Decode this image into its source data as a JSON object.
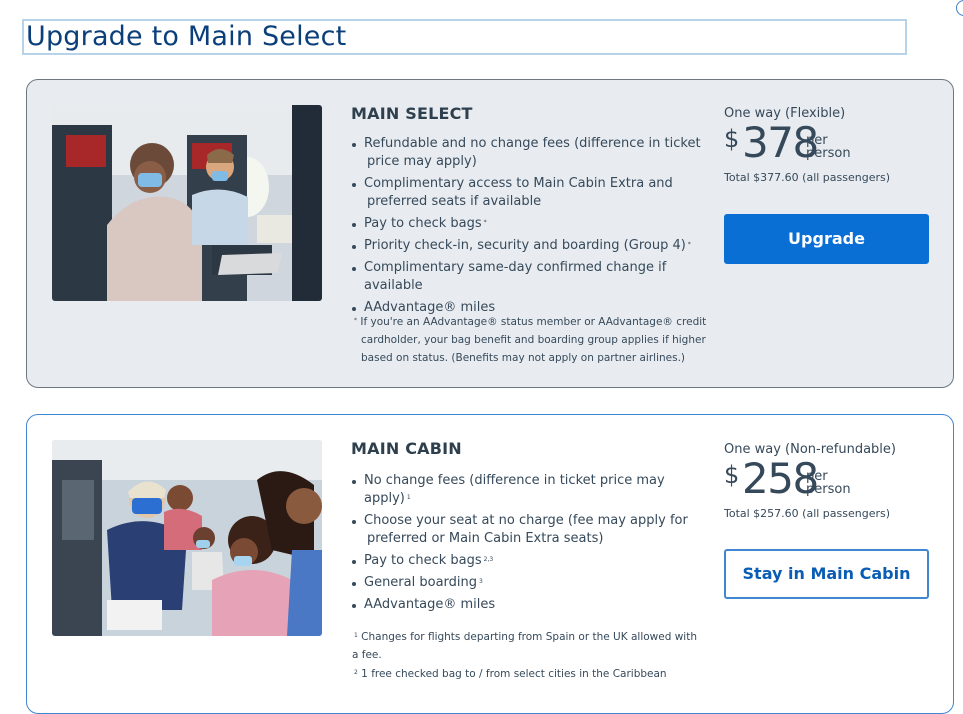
{
  "page": {
    "title": "Upgrade to Main Select"
  },
  "fares": [
    {
      "name": "MAIN SELECT",
      "benefits": [
        {
          "line1": "Refundable and no change fees (difference in ticket",
          "line2": "price may apply)",
          "sup": ""
        },
        {
          "line1": "Complimentary access to Main Cabin Extra and",
          "line2": "preferred seats if available",
          "sup": ""
        },
        {
          "line1": "Pay to check bags",
          "line2": "",
          "sup": "*"
        },
        {
          "line1": "Priority check-in, security and boarding (Group 4)",
          "line2": "",
          "sup": "*"
        },
        {
          "line1": "Complimentary same-day confirmed change if available",
          "line2": "",
          "sup": ""
        },
        {
          "line1": "AAdvantage® miles",
          "line2": "",
          "sup": ""
        }
      ],
      "footnote_mark": "*",
      "footnote_lines": [
        "If you're an AAdvantage® status member or AAdvantage® credit",
        "cardholder, your bag benefit and boarding group applies if higher",
        "based on status. (Benefits may not apply on partner airlines.)"
      ],
      "fare_type": "One way (Flexible)",
      "currency": "$",
      "amount": "378",
      "per_1": "per",
      "per_2": "person",
      "total": "Total $377.60 (all passengers)",
      "button": "Upgrade"
    },
    {
      "name": "MAIN CABIN",
      "benefits": [
        {
          "line1": "No change fees (difference in ticket price may apply)",
          "line2": "",
          "sup": "1"
        },
        {
          "line1": "Choose your seat at no charge (fee may apply for",
          "line2": "preferred or Main Cabin Extra seats)",
          "sup": ""
        },
        {
          "line1": "Pay to check bags",
          "line2": "",
          "sup": "2,3"
        },
        {
          "line1": "General boarding",
          "line2": "",
          "sup": "3"
        },
        {
          "line1": "AAdvantage® miles",
          "line2": "",
          "sup": ""
        }
      ],
      "footnotes": [
        {
          "mark": "1",
          "line1": "Changes for flights departing from Spain or the UK allowed with",
          "line2": "a fee."
        },
        {
          "mark": "2",
          "line1": "1 free checked bag to / from select cities in the Caribbean",
          "line2": ""
        }
      ],
      "fare_type": "One way (Non-refundable)",
      "currency": "$",
      "amount": "258",
      "per_1": "per",
      "per_2": "person",
      "total": "Total $257.60 (all passengers)",
      "button": "Stay in Main Cabin"
    }
  ],
  "colors": {
    "brand_blue": "#0a6fd4",
    "title_blue": "#0b3f7a",
    "card_gray": "#e8ecf0",
    "text": "#36495a"
  }
}
